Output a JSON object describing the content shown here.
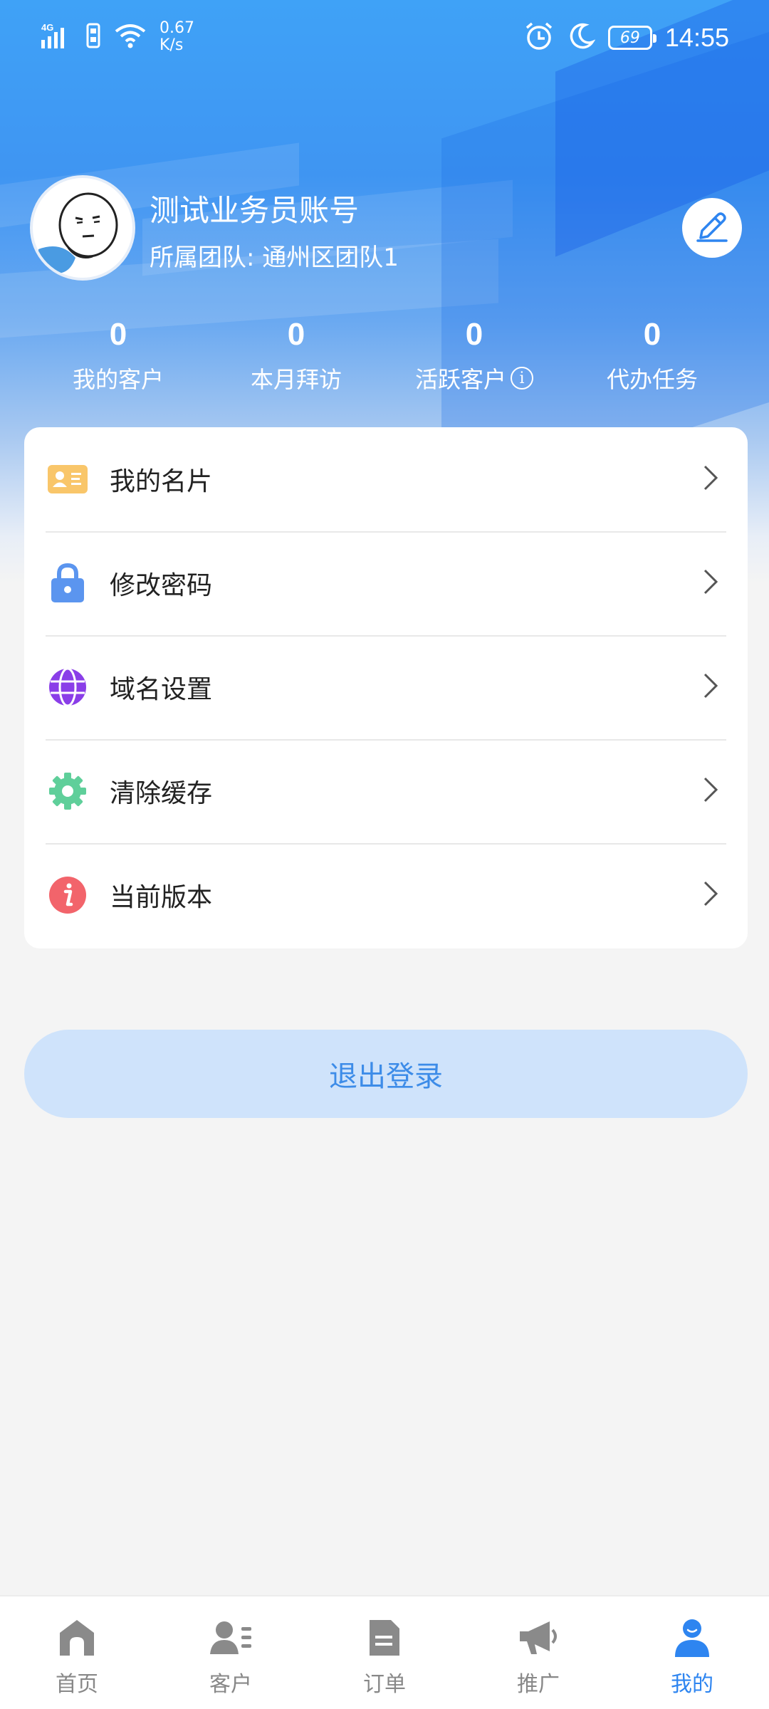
{
  "status_bar": {
    "network": "4G",
    "speed_value": "0.67",
    "speed_unit": "K/s",
    "battery": "69",
    "time": "14:55"
  },
  "profile": {
    "name": "测试业务员账号",
    "team": "所属团队: 通州区团队1"
  },
  "stats": [
    {
      "value": "0",
      "label": "我的客户"
    },
    {
      "value": "0",
      "label": "本月拜访"
    },
    {
      "value": "0",
      "label": "活跃客户"
    },
    {
      "value": "0",
      "label": "代办任务"
    }
  ],
  "menu": [
    {
      "label": "我的名片",
      "icon": "business-card-icon",
      "color": "#f9c66a"
    },
    {
      "label": "修改密码",
      "icon": "lock-icon",
      "color": "#5b95ef"
    },
    {
      "label": "域名设置",
      "icon": "globe-icon",
      "color": "#8a3ee8"
    },
    {
      "label": "清除缓存",
      "icon": "gear-icon",
      "color": "#5fcf9a"
    },
    {
      "label": "当前版本",
      "icon": "info-icon",
      "color": "#f2646b"
    }
  ],
  "logout_label": "退出登录",
  "bottom_nav": [
    {
      "label": "首页",
      "icon": "home-icon",
      "active": false
    },
    {
      "label": "客户",
      "icon": "customers-icon",
      "active": false
    },
    {
      "label": "订单",
      "icon": "order-icon",
      "active": false
    },
    {
      "label": "推广",
      "icon": "megaphone-icon",
      "active": false
    },
    {
      "label": "我的",
      "icon": "profile-icon",
      "active": true
    }
  ],
  "colors": {
    "accent": "#2e85f0",
    "logout_bg": "#cfe3fb",
    "nav_inactive": "#888888"
  }
}
